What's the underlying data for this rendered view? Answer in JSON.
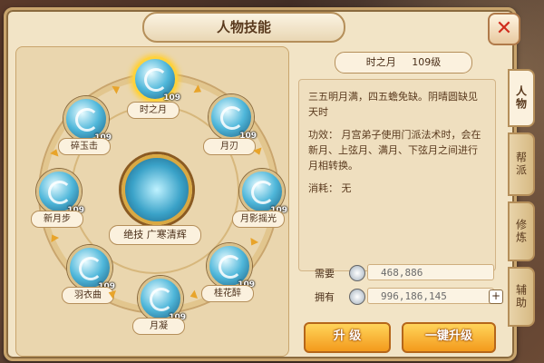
{
  "window": {
    "title": "人物技能"
  },
  "skills": [
    {
      "name": "时之月",
      "level": "109",
      "selected": true
    },
    {
      "name": "月刃",
      "level": "109"
    },
    {
      "name": "月影摇光",
      "level": "109"
    },
    {
      "name": "桂花醉",
      "level": "109"
    },
    {
      "name": "月凝",
      "level": "109"
    },
    {
      "name": "羽衣曲",
      "level": "109"
    },
    {
      "name": "新月步",
      "level": "109"
    },
    {
      "name": "碎玉击",
      "level": "109"
    }
  ],
  "center_skill": {
    "label": "绝技 广寒清辉"
  },
  "detail": {
    "title": "时之月",
    "level": "109级",
    "desc": "三五明月满，四五蟾免缺。阴晴圆缺见天时",
    "effect": "功效：  月宫弟子使用门派法术时，会在新月、上弦月、满月、下弦月之间进行月相转换。",
    "cost": "消耗：  无"
  },
  "cost_rows": {
    "need_label": "需要",
    "need_value": "468,886",
    "have_label": "拥有",
    "have_value": "996,186,145",
    "plus": "+"
  },
  "buttons": {
    "upgrade": "升 级",
    "one_click_upgrade": "一键升级"
  },
  "tabs": [
    {
      "label": "人物",
      "active": true
    },
    {
      "label": "帮派"
    },
    {
      "label": "修炼"
    },
    {
      "label": "辅助"
    }
  ],
  "colors": {
    "accent": "#f39a1c",
    "panel": "#f2e4c6",
    "close": "#d02c1c"
  }
}
